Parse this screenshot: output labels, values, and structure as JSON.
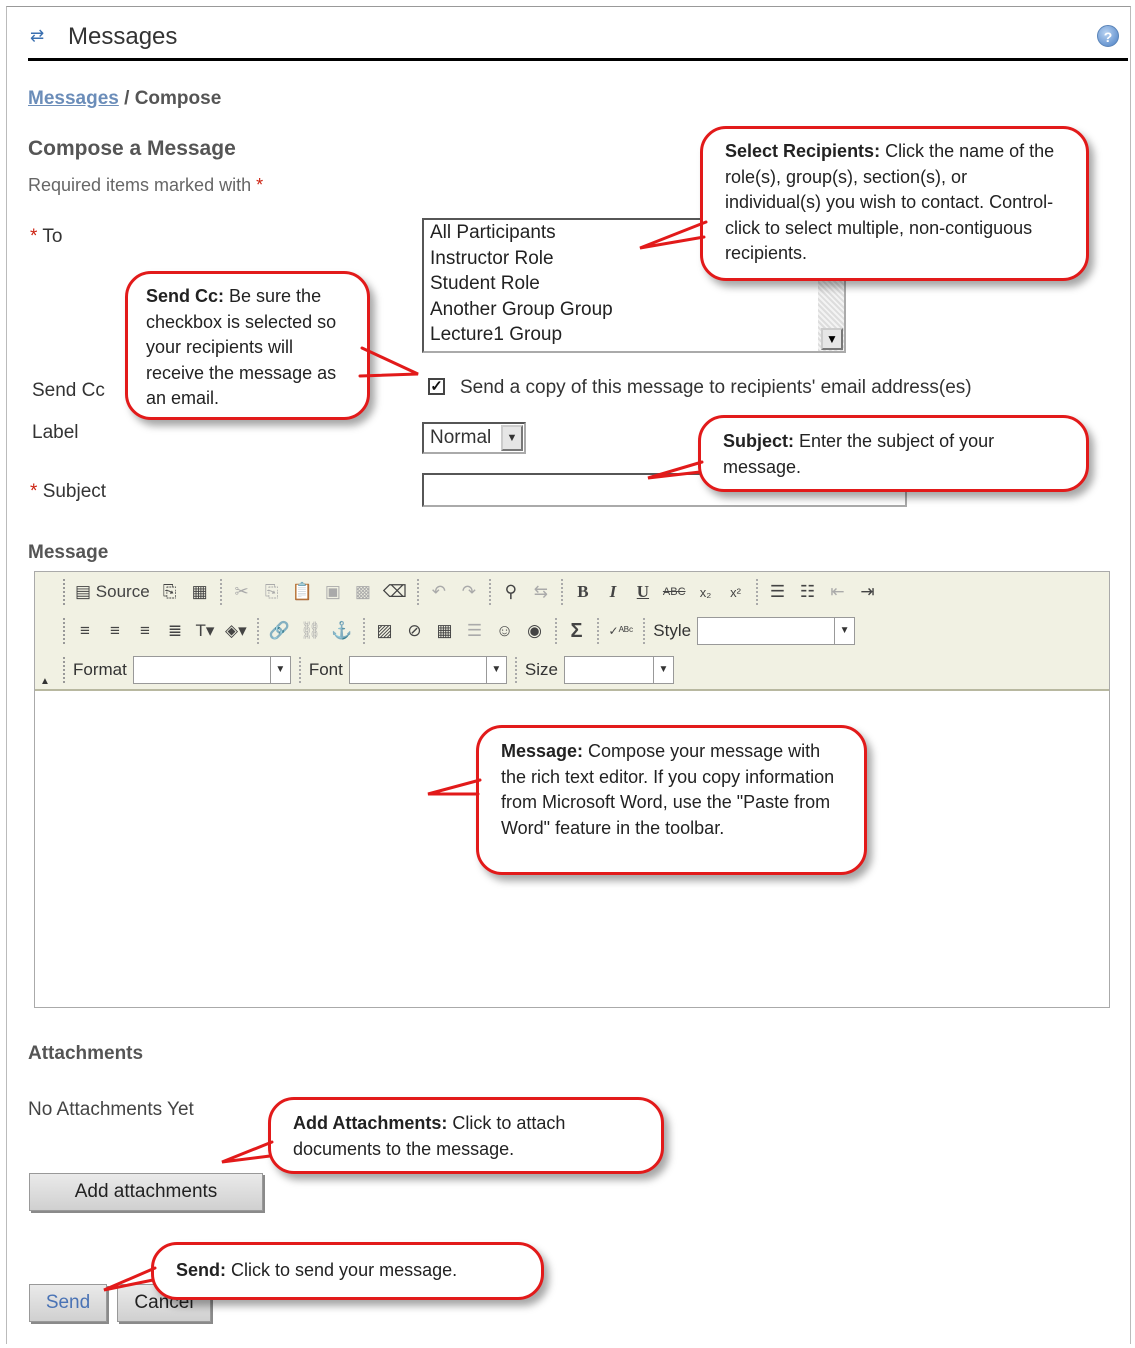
{
  "header": {
    "icon": "swap-arrows-icon",
    "title": "Messages",
    "help_icon": "help-icon",
    "help_glyph": "?"
  },
  "breadcrumb": {
    "link": "Messages",
    "separator": " / ",
    "current": "Compose"
  },
  "form": {
    "heading": "Compose a Message",
    "required_note": "Required items marked with",
    "required_star": "*",
    "to_label": "To",
    "recipients": [
      "All Participants",
      "Instructor Role",
      "Student Role",
      "Another Group Group",
      "Lecture1 Group"
    ],
    "send_cc_label": "Send Cc",
    "send_cc_checked": true,
    "send_cc_text": "Send a copy of this message to recipients' email address(es)",
    "label_label": "Label",
    "label_value": "Normal",
    "subject_label": "Subject",
    "subject_value": ""
  },
  "editor": {
    "heading": "Message",
    "source_label": "Source",
    "style_label": "Style",
    "format_label": "Format",
    "font_label": "Font",
    "size_label": "Size"
  },
  "attachments": {
    "heading": "Attachments",
    "empty_text": "No Attachments Yet",
    "add_button": "Add attachments"
  },
  "actions": {
    "send": "Send",
    "cancel": "Cancel"
  },
  "callouts": {
    "recipients": {
      "title": "Select Recipients:",
      "text": " Click the name of the role(s), group(s), section(s), or individual(s) you wish to contact. Control-click to select multiple, non-contiguous recipients."
    },
    "send_cc": {
      "title": "Send Cc:",
      "text": " Be sure the checkbox is selected so your recipients will receive the message as an email."
    },
    "subject": {
      "title": "Subject:",
      "text": " Enter the subject of your message."
    },
    "message": {
      "title": "Message:",
      "text": " Compose your message with the rich text editor. If you copy information from Microsoft Word, use the \"Paste from Word\" feature in the toolbar."
    },
    "attachments": {
      "title": "Add Attachments:",
      "text": " Click to attach documents to the message."
    },
    "send": {
      "title": "Send:",
      "text": " Click to send your message."
    }
  },
  "colors": {
    "callout_border": "#e21a1a",
    "link": "#6b8db9",
    "required": "#cc2211"
  }
}
